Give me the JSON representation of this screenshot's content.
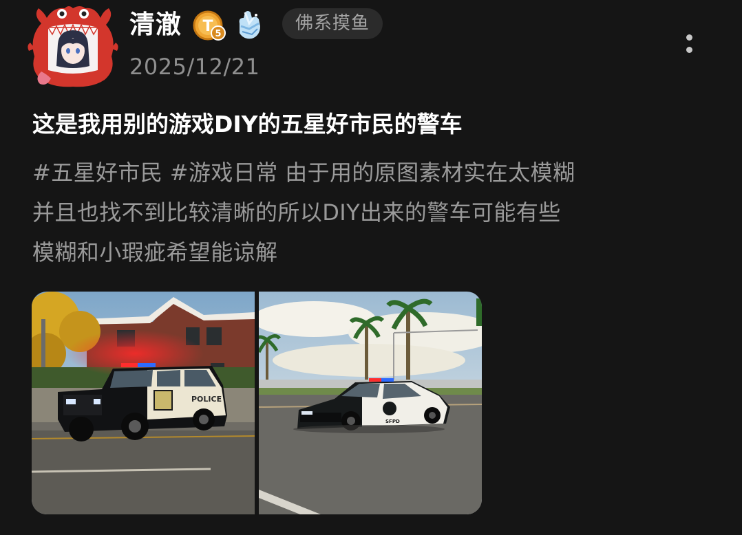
{
  "author": {
    "name": "清澈",
    "level": "5",
    "level_badge_icon": "level-badge-t5",
    "medal_icon": "ice-crystal-hand-icon",
    "group_tag": "佛系摸鱼"
  },
  "post": {
    "date": "2025/12/21",
    "title": "这是我用别的游戏DIY的五星好市民的警车",
    "hashtags": [
      "#五星好市民",
      "#游戏日常"
    ],
    "body_line1_rest": " 由于用的原图素材实在太模糊",
    "body_line2": "并且也找不到比较清晰的所以DIY出来的警车可能有些",
    "body_line3": "模糊和小瑕疵希望能谅解",
    "images": [
      {
        "label": "POLICE"
      },
      {
        "label": "SFPD"
      }
    ]
  },
  "theme": {
    "background": "#151515",
    "text_primary": "#ffffff",
    "text_secondary": "#9a9a9a",
    "badge_gold": "#e8a23a",
    "tag_background": "#2b2b2b"
  }
}
